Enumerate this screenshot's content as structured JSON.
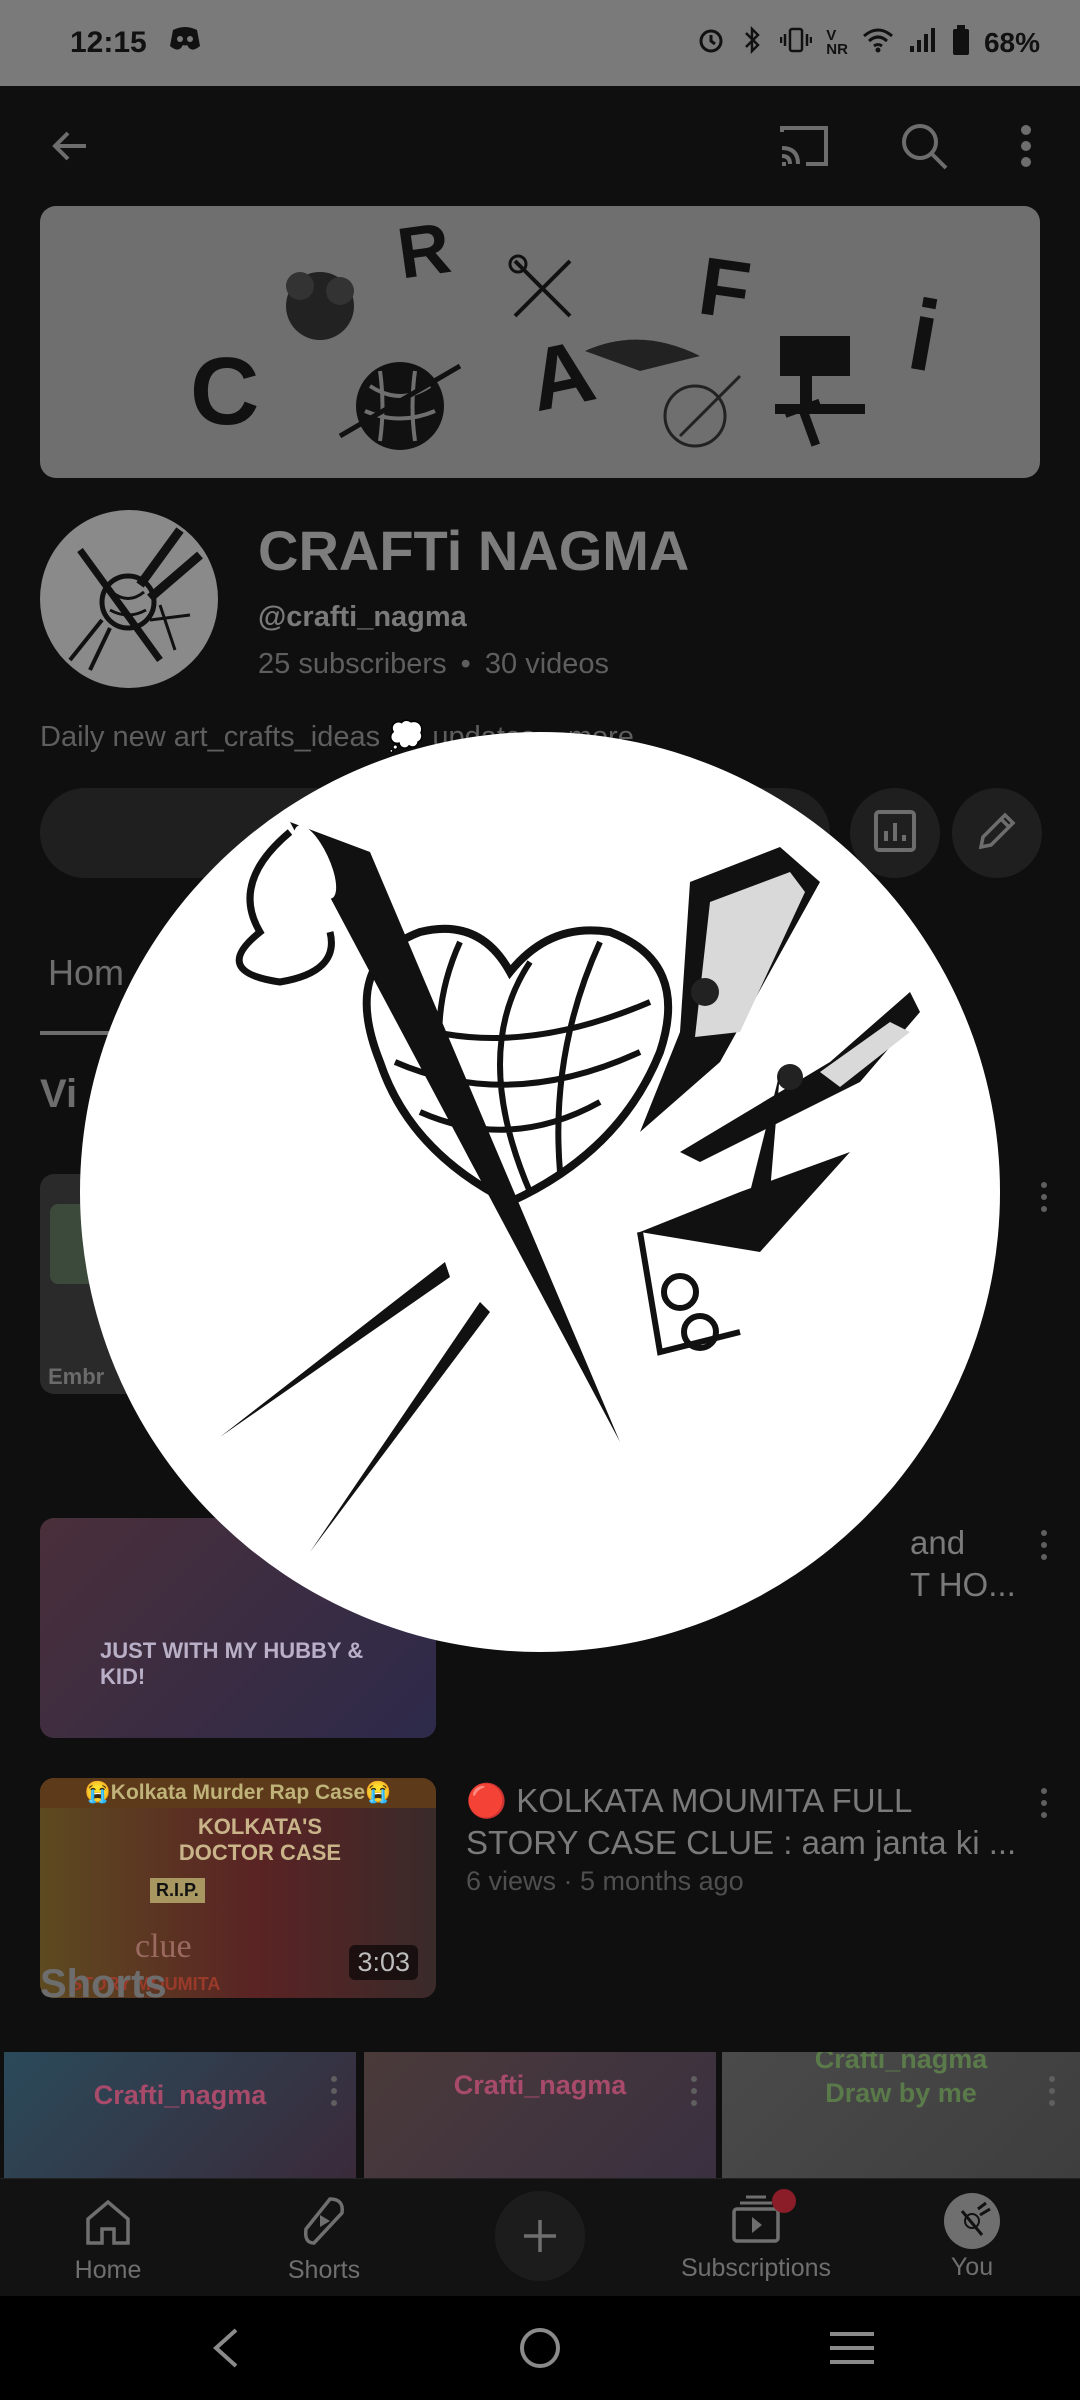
{
  "status_bar": {
    "time": "12:15",
    "battery": "68%",
    "icons": [
      "discord-icon",
      "alarm-icon",
      "bluetooth-icon",
      "vibrate-icon",
      "volte-icon",
      "wifi-icon",
      "signal-icon",
      "battery-icon"
    ]
  },
  "header": {
    "back_icon": "arrow-left-icon",
    "cast_icon": "cast-icon",
    "search_icon": "search-icon",
    "more_icon": "more-vert-icon"
  },
  "banner": {
    "letters": [
      "C",
      "R",
      "A",
      "F",
      "T",
      "i"
    ]
  },
  "channel": {
    "name": "CRAFTi NAGMA",
    "handle": "@crafti_nagma",
    "subscribers": "25 subscribers",
    "separator": "•",
    "videos": "30 videos",
    "description": "Daily new art_crafts_ideas 💭 updates ...more"
  },
  "tabs": {
    "home": "Hom"
  },
  "sections": {
    "videos_title": "Vi",
    "shorts_title": "Shorts"
  },
  "videos": [
    {
      "thumb_text": "Embr",
      "title": "",
      "meta": ""
    },
    {
      "thumb_text": "JUST WITH MY HUBBY & KID!",
      "title_line1": "and",
      "title_line2": "T HO...",
      "meta": ""
    },
    {
      "thumb_header": "😭Kolkata Murder Rap Case😭",
      "thumb_text": "KOLKATA'S DOCTOR CASE",
      "thumb_rip": "R.I.P.",
      "thumb_clue": "clue",
      "thumb_bottom": "STORY MOUMITA",
      "duration": "3:03",
      "title": "🔴 KOLKATA MOUMITA FULL STORY CASE CLUE : aam janta ki ...",
      "meta": "6 views · 5 months ago"
    }
  ],
  "shorts": [
    {
      "label": "Crafti_nagma"
    },
    {
      "label": "Crafti_nagma"
    },
    {
      "label_line1": "Crafti_nagma",
      "label_line2": "Draw by me"
    }
  ],
  "bottom_nav": {
    "home": "Home",
    "shorts": "Shorts",
    "subscriptions": "Subscriptions",
    "you": "You"
  },
  "colors": {
    "background": "#0f0f0f",
    "overlay_circle": "#ffffff",
    "notification_dot": "#e0263a"
  }
}
